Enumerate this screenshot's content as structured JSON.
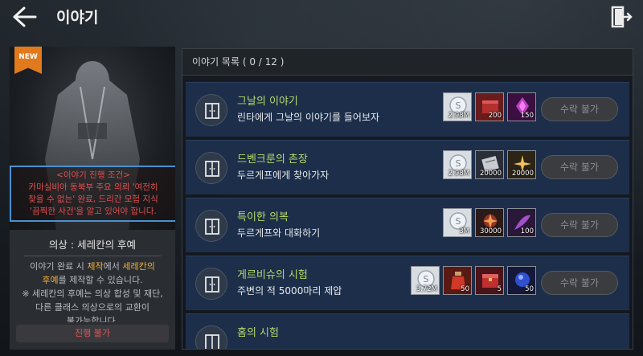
{
  "header": {
    "title": "이야기"
  },
  "left": {
    "new_badge": "NEW",
    "condition_lines": [
      "<이야기 진행 조건>",
      "카마실비아 동북부 주요 의뢰 '여전히",
      "찾을 수 없는' 완료, 드리간 모험 지식",
      "'끔찍한 사건'을 알고 있어야 합니다."
    ],
    "costume_name": "의상 : 세레칸의 후예",
    "desc_line1_a": "이야기 완료 시 ",
    "desc_line1_b": "제작",
    "desc_line1_c": "에서 ",
    "desc_line1_d": "세레칸의",
    "desc_line2_a": "후예",
    "desc_line2_b": "를 제작할 수 있습니다.",
    "desc_line3": "※ 세레칸의 후예는 의상 합성 및 재단,",
    "desc_line4": "다른 클래스 의상으로의 교환이",
    "desc_line5": "불가능합니다.",
    "progress_button": "진행 불가"
  },
  "list": {
    "header": "이야기 목록 ( 0 / 12 )",
    "items": [
      {
        "title": "그날의 이야기",
        "desc": "린타에게 그날의 이야기를 들어보자",
        "rewards": [
          {
            "icon": "silver-coin-icon",
            "amount": "2.98M"
          },
          {
            "icon": "red-crate-icon",
            "amount": "200"
          },
          {
            "icon": "purple-crystal-icon",
            "amount": "150"
          }
        ],
        "button": "수락 불가"
      },
      {
        "title": "드벤크룬의 촌장",
        "desc": "두르게프에게 찾아가자",
        "rewards": [
          {
            "icon": "silver-coin-icon",
            "amount": "2.98M"
          },
          {
            "icon": "scroll-icon",
            "amount": "20000"
          },
          {
            "icon": "sparkle-icon",
            "amount": "20000"
          }
        ],
        "button": "수락 불가"
      },
      {
        "title": "특이한 의복",
        "desc": "두르게프와 대화하기",
        "rewards": [
          {
            "icon": "silver-coin-icon",
            "amount": "3M"
          },
          {
            "icon": "sparkle-icon",
            "amount": "30000"
          },
          {
            "icon": "feather-icon",
            "amount": "100"
          }
        ],
        "button": "수락 불가"
      },
      {
        "title": "게르비슈의 시험",
        "desc": "주변의 적 5000마리 제압",
        "rewards": [
          {
            "icon": "silver-coin-icon",
            "amount": "3.72M"
          },
          {
            "icon": "potion-icon",
            "amount": "50"
          },
          {
            "icon": "red-chest-icon",
            "amount": "5"
          },
          {
            "icon": "blue-gem-icon",
            "amount": "50"
          }
        ],
        "button": "수락 불가"
      },
      {
        "title": "홈의 시험",
        "desc": "",
        "rewards": [],
        "button": ""
      }
    ]
  },
  "colors": {
    "title_green": "#b6d96a",
    "warning_red": "#e05050",
    "highlight_orange": "#f0b040",
    "row_blue": "#1c2e4a",
    "badge_orange": "#e07a1c"
  }
}
